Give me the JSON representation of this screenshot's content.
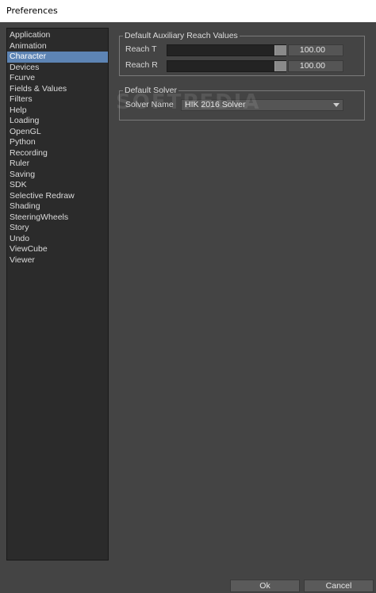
{
  "window": {
    "title": "Preferences"
  },
  "sidebar": {
    "selected_index": 2,
    "items": [
      {
        "label": "Application"
      },
      {
        "label": "Animation"
      },
      {
        "label": "Character"
      },
      {
        "label": "Devices"
      },
      {
        "label": "Fcurve"
      },
      {
        "label": "Fields & Values"
      },
      {
        "label": "Filters"
      },
      {
        "label": "Help"
      },
      {
        "label": "Loading"
      },
      {
        "label": "OpenGL"
      },
      {
        "label": "Python"
      },
      {
        "label": "Recording"
      },
      {
        "label": "Ruler"
      },
      {
        "label": "Saving"
      },
      {
        "label": "SDK"
      },
      {
        "label": "Selective Redraw"
      },
      {
        "label": "Shading"
      },
      {
        "label": "SteeringWheels"
      },
      {
        "label": "Story"
      },
      {
        "label": "Undo"
      },
      {
        "label": "ViewCube"
      },
      {
        "label": "Viewer"
      }
    ]
  },
  "reach_group": {
    "title": "Default Auxiliary Reach Values",
    "reach_t": {
      "label": "Reach T",
      "value": "100.00",
      "level": 1.0
    },
    "reach_r": {
      "label": "Reach R",
      "value": "100.00",
      "level": 1.0
    }
  },
  "solver_group": {
    "title": "Default Solver",
    "solver_name_label": "Solver Name",
    "solver_value": "HIK 2016 Solver"
  },
  "watermark": "SOFTPEDIA",
  "footer": {
    "ok_label": "Ok",
    "cancel_label": "Cancel"
  },
  "colors": {
    "background": "#444444",
    "sidebar_bg": "#2b2b2b",
    "selected": "#5d84b4"
  },
  "icons": {
    "dropdown_arrow": "chevron-down-icon"
  }
}
